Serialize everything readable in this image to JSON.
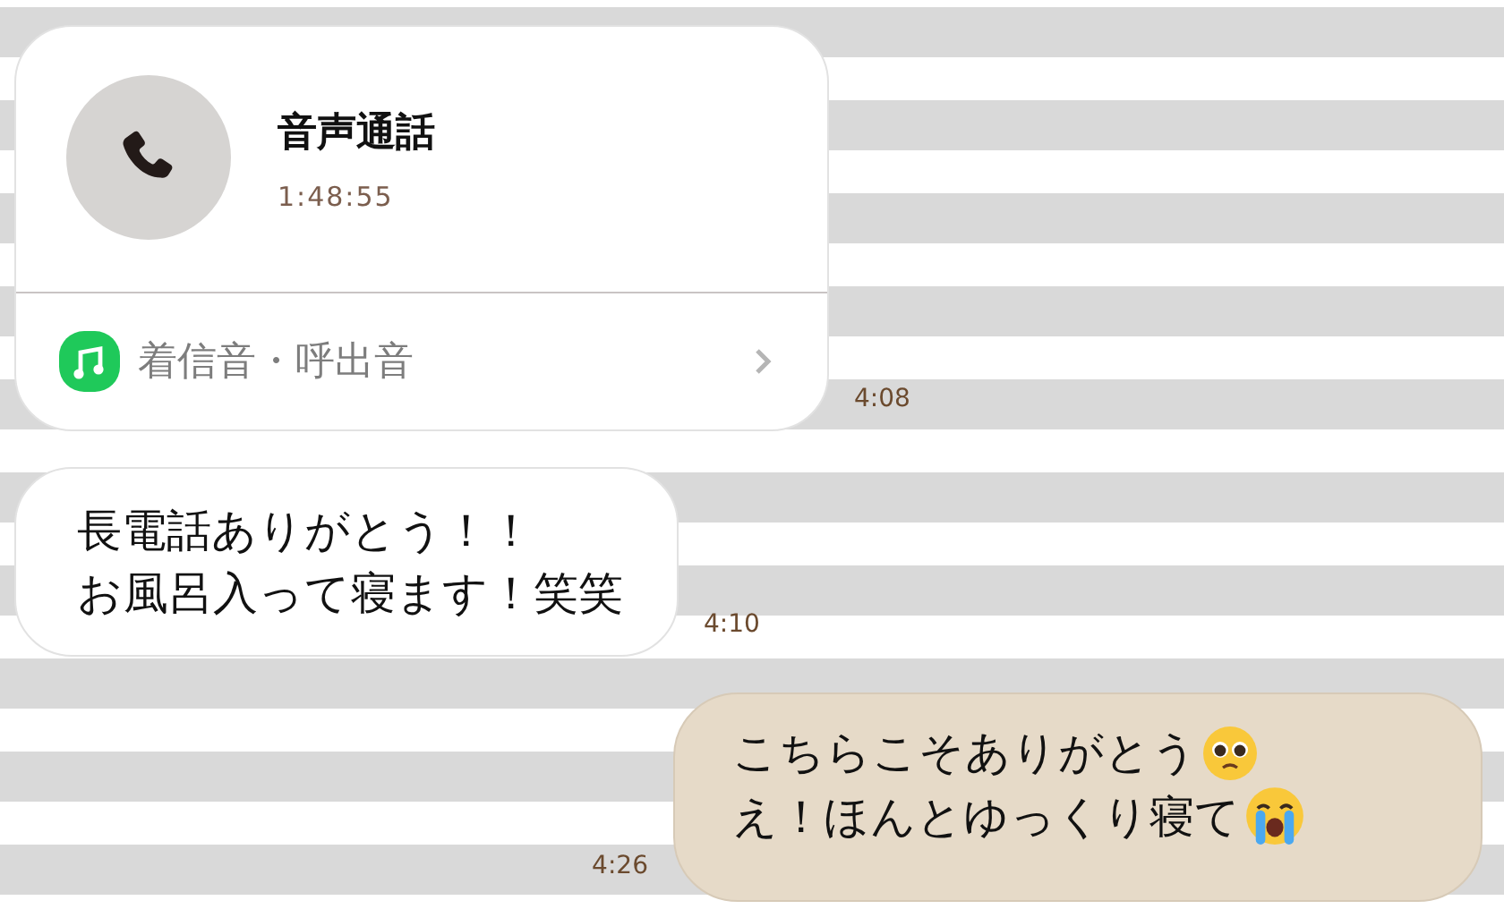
{
  "messages": [
    {
      "kind": "call",
      "mine": false,
      "title": "音声通話",
      "duration": "1:48:55",
      "action": "着信音・呼出音",
      "time": "4:08"
    },
    {
      "kind": "text",
      "mine": false,
      "lines": [
        {
          "kind": "plain",
          "text": "長電話ありがとう！！"
        },
        {
          "kind": "plain",
          "text": "お風呂入って寝ます！笑笑"
        }
      ],
      "time": "4:10"
    },
    {
      "kind": "text",
      "mine": true,
      "lines": [
        {
          "kind": "pleading",
          "text": "こちらこそありがとう"
        },
        {
          "kind": "crying",
          "text": "え！ほんとゆっくり寝て"
        }
      ],
      "time": "4:26"
    }
  ]
}
